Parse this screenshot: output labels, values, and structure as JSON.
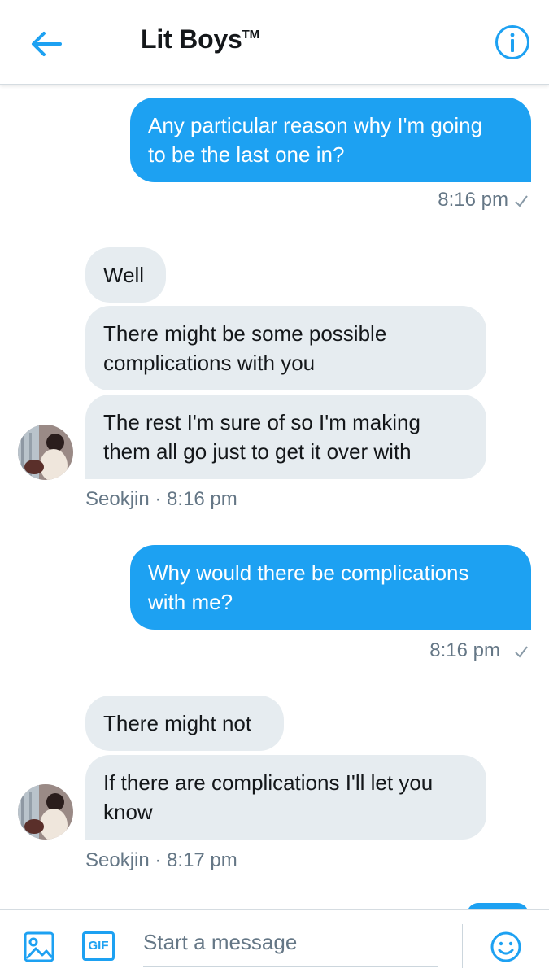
{
  "header": {
    "title": "Lit Boys",
    "trademark": "TM",
    "back_icon": "back-arrow-icon",
    "info_icon": "info-icon",
    "accent_color": "#1da1f2"
  },
  "messages": [
    {
      "direction": "outgoing",
      "lines": [
        "Any particular reason why I'm going",
        "to be the last one in?"
      ],
      "time": "8:16 pm"
    },
    {
      "direction": "incoming",
      "text": "Well"
    },
    {
      "direction": "incoming",
      "lines": [
        "There might be some possible",
        "complications with you"
      ]
    },
    {
      "direction": "incoming",
      "lines": [
        "The rest I'm sure of so I'm making",
        "them all go just to get it over with"
      ],
      "sender": "Seokjin",
      "time": "8:16 pm"
    },
    {
      "direction": "outgoing",
      "lines": [
        "Why would there be complications",
        "with me?"
      ],
      "time": "8:16 pm"
    },
    {
      "direction": "incoming",
      "text": "There might not"
    },
    {
      "direction": "incoming",
      "lines": [
        "If there are complications I'll let you",
        "know"
      ],
      "sender": "Seokjin",
      "time": "8:17 pm"
    }
  ],
  "meta_separator": " · ",
  "composer": {
    "placeholder": "Start a message",
    "gif_label": "GIF",
    "image_icon": "image-icon",
    "emoji_icon": "emoji-icon"
  }
}
